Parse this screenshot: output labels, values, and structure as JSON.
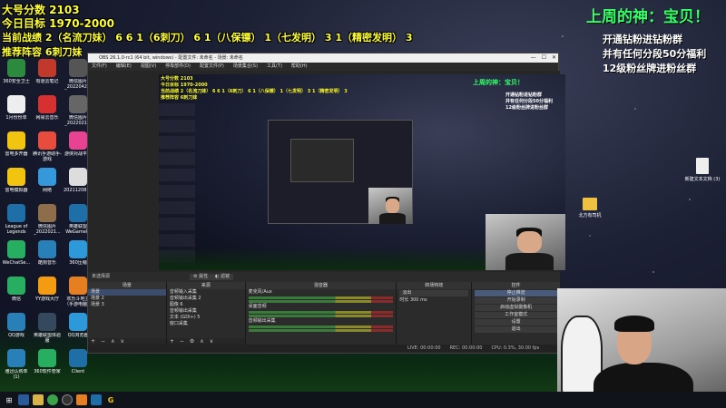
{
  "overlay": {
    "line1": "大号分数 2103",
    "line2": "今日目标 1970-2000",
    "line3": "当前战绩 2（名流刀妹） 6 6 1（6刺刀） 6 1（八保镖） 1（七发明） 3 1（精密发明） 3",
    "line4": "推荐阵容 6刺刀妹",
    "god_title": "上周的神：宝贝！",
    "promo": [
      "开通钻粉进钻粉群",
      "并有任何分段50分福利",
      "12级粉丝牌进粉丝群"
    ]
  },
  "desktop_icons": [
    {
      "label": "360安全卫士",
      "color": "#2b8a3e",
      "icon": "shield-icon"
    },
    {
      "label": "有道云笔记",
      "color": "#c0392b",
      "icon": "note-icon"
    },
    {
      "label": "微信图片_2022042...",
      "color": "#555555",
      "icon": "image-icon"
    },
    {
      "label": "1月份份单",
      "color": "#eeeeee",
      "icon": "doc-icon"
    },
    {
      "label": "网易云音乐",
      "color": "#d63031",
      "icon": "music-icon"
    },
    {
      "label": "微信图片_2022021...",
      "color": "#666666",
      "icon": "image-icon"
    },
    {
      "label": "雷电多开器",
      "color": "#f1c40f",
      "icon": "phone-icon"
    },
    {
      "label": "腾讯手游助手-游戏",
      "color": "#e74c3c",
      "icon": "game-icon"
    },
    {
      "label": "游侠对战平台",
      "color": "#e84393",
      "icon": "game-icon"
    },
    {
      "label": "雷电模拟器",
      "color": "#f1c40f",
      "icon": "phone-icon"
    },
    {
      "label": "网络",
      "color": "#3498db",
      "icon": "network-icon"
    },
    {
      "label": "2021120813...",
      "color": "#dddddd",
      "icon": "doc-icon"
    },
    {
      "label": "League of Legends",
      "color": "#1e6fa8",
      "icon": "lol-icon"
    },
    {
      "label": "微信图片_2022021...",
      "color": "#8e6e4a",
      "icon": "image-icon"
    },
    {
      "label": "英雄联盟WeGame版",
      "color": "#1e6fa8",
      "icon": "lol-icon"
    },
    {
      "label": "WeChatSe...",
      "color": "#27ae60",
      "icon": "wechat-icon"
    },
    {
      "label": "酷狗音乐",
      "color": "#2980b9",
      "icon": "music-icon"
    },
    {
      "label": "360压缩",
      "color": "#2d98da",
      "icon": "folder-icon"
    },
    {
      "label": "微信",
      "color": "#27ae60",
      "icon": "wechat-icon"
    },
    {
      "label": "YY游戏大厅",
      "color": "#f39c12",
      "icon": "game-icon"
    },
    {
      "label": "欢乐斗地主（手游电脑）",
      "color": "#e67e22",
      "icon": "card-icon"
    },
    {
      "label": "QQ游戏",
      "color": "#2980b9",
      "icon": "qq-icon"
    },
    {
      "label": "英雄联盟体验服",
      "color": "#34495e",
      "icon": "lol-icon"
    },
    {
      "label": "QQ浏览器",
      "color": "#2d98da",
      "icon": "browser-icon"
    },
    {
      "label": "雅迅认购单(1)",
      "color": "#2980b9",
      "icon": "doc-icon"
    },
    {
      "label": "360软件管家",
      "color": "#27ae60",
      "icon": "store-icon"
    },
    {
      "label": "Client",
      "color": "#1e6fa8",
      "icon": "lol-icon"
    }
  ],
  "right_icons": [
    {
      "label": "新建文本文档 (3)",
      "type": "doc"
    },
    {
      "label": "北方有司机",
      "type": "folder"
    }
  ],
  "obs": {
    "title": "OBS 26.1.0-rc1 (64 bit, windows) - 配置文件: 未命名 - 场景: 未命名",
    "menu": [
      "文件(F)",
      "编辑(E)",
      "视图(V)",
      "停靠部件(D)",
      "配置文件(P)",
      "场景集合(S)",
      "工具(T)",
      "帮助(H)"
    ],
    "no_source": "未选择源",
    "props_label": "属性",
    "filter_label": "滤镜",
    "docks": {
      "scenes": {
        "title": "场景",
        "items": [
          "场景",
          "场景 2",
          "场景 3"
        ]
      },
      "sources": {
        "title": "来源",
        "items": [
          "音频输入采集",
          "音频输出采集 2",
          "图像 6",
          "音频输出采集",
          "文本 (GDI+) 5",
          "窗口采集"
        ]
      },
      "mixer": {
        "title": "混音器",
        "channels": [
          "麦克风/Aux",
          "桌面音频",
          "音频输出采集"
        ]
      },
      "transitions": {
        "title": "转场特效",
        "type": "淡出",
        "duration_label": "时长",
        "duration": "300 ms"
      },
      "controls": {
        "title": "控件",
        "buttons": [
          "停止推流",
          "开始录制",
          "启动虚拟摄像机",
          "工作室模式",
          "设置",
          "退出"
        ]
      }
    },
    "status": {
      "live": "LIVE: 00:00:00",
      "rec": "REC: 00:00:00",
      "cpu": "CPU: 0.3%, 30.00 fps"
    }
  }
}
